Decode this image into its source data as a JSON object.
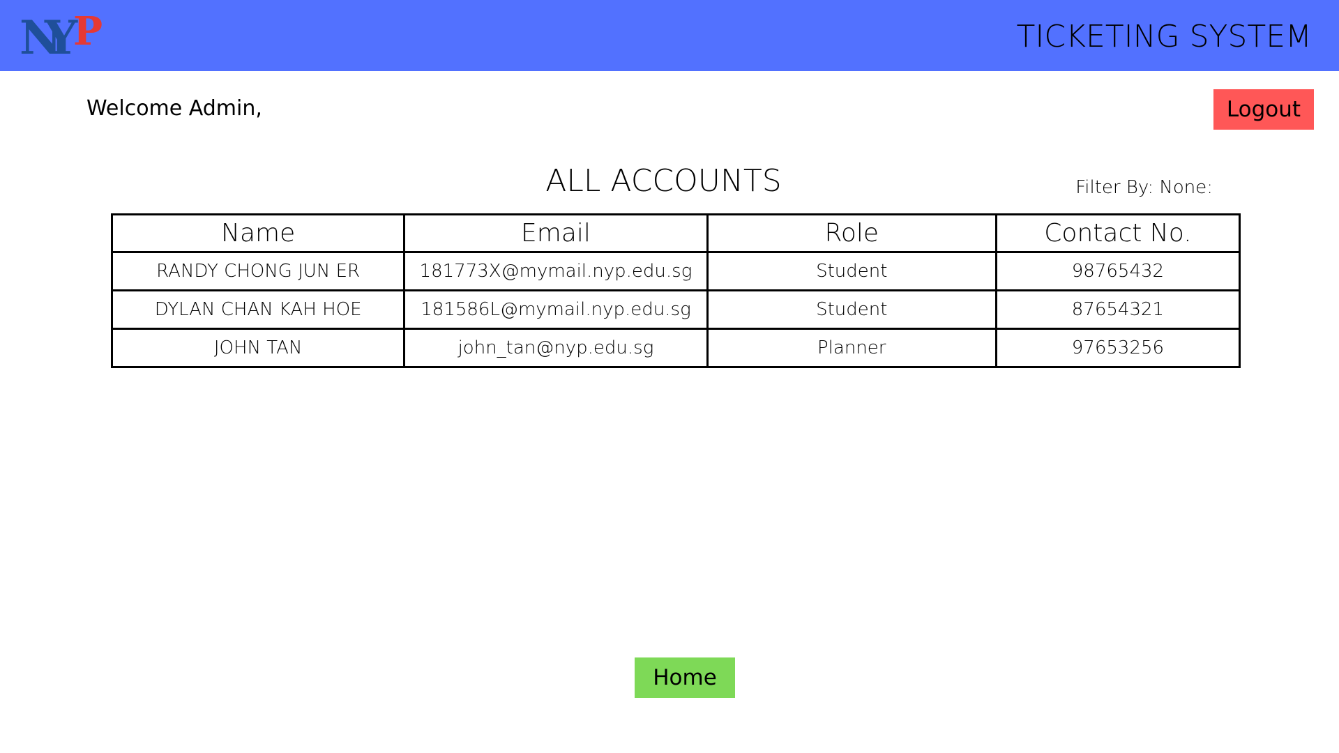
{
  "header": {
    "logo": {
      "letters": [
        "N",
        "Y",
        "P"
      ],
      "colors": {
        "blue": "#1f4f9a",
        "red": "#e53935"
      }
    },
    "system_title": "TICKETING SYSTEM",
    "background": "#5271ff"
  },
  "welcome_text": "Welcome Admin,",
  "logout": {
    "label": "Logout",
    "color": "#ff5757"
  },
  "page_title": "ALL ACCOUNTS",
  "filter_text": "Filter By: None:",
  "table": {
    "columns": [
      "Name",
      "Email",
      "Role",
      "Contact No."
    ],
    "rows": [
      {
        "name": "RANDY CHONG JUN ER",
        "email": "181773X@mymail.nyp.edu.sg",
        "role": "Student",
        "contact": "98765432"
      },
      {
        "name": "DYLAN CHAN KAH HOE",
        "email": "181586L@mymail.nyp.edu.sg",
        "role": "Student",
        "contact": "87654321"
      },
      {
        "name": "JOHN TAN",
        "email": "john_tan@nyp.edu.sg",
        "role": "Planner",
        "contact": "97653256"
      }
    ]
  },
  "home": {
    "label": "Home",
    "color": "#7ed957"
  }
}
